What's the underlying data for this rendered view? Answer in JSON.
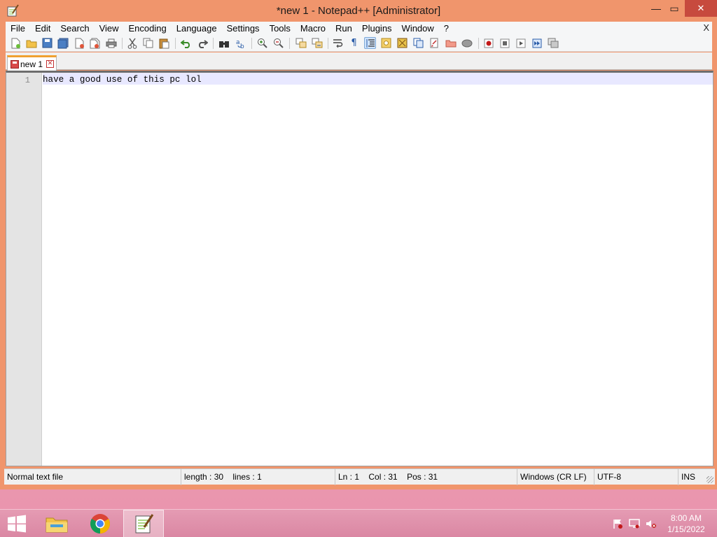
{
  "window": {
    "title": "*new 1 - Notepad++ [Administrator]",
    "controls": {
      "minimize": "—",
      "maximize": "▭",
      "close": "✕"
    }
  },
  "menu": {
    "items": [
      "File",
      "Edit",
      "Search",
      "View",
      "Encoding",
      "Language",
      "Settings",
      "Tools",
      "Macro",
      "Run",
      "Plugins",
      "Window",
      "?"
    ],
    "close_doc": "X"
  },
  "toolbar": {
    "icons": [
      "new-file-icon",
      "open-file-icon",
      "save-icon",
      "save-all-icon",
      "close-icon",
      "close-all-icon",
      "print-icon",
      "cut-icon",
      "copy-icon",
      "paste-icon",
      "undo-icon",
      "redo-icon",
      "find-icon",
      "replace-icon",
      "zoom-in-icon",
      "zoom-out-icon",
      "sync-vertical-icon",
      "sync-horizontal-icon",
      "word-wrap-icon",
      "show-all-chars-icon",
      "indent-guide-icon",
      "user-lang-icon",
      "doc-map-icon",
      "function-list-icon",
      "folder-workspace-icon",
      "monitoring-icon",
      "record-macro-icon",
      "stop-macro-icon",
      "play-macro-icon",
      "run-macro-multiple-icon",
      "save-macro-icon"
    ]
  },
  "tabs": [
    {
      "label": "new 1",
      "close": "✕"
    }
  ],
  "editor": {
    "line_number": "1",
    "text": "have a good use of this pc lol"
  },
  "status": {
    "file_type": "Normal text file",
    "length": "length : 30",
    "lines": "lines : 1",
    "ln": "Ln : 1",
    "col": "Col : 31",
    "pos": "Pos : 31",
    "eol": "Windows (CR LF)",
    "encoding": "UTF-8",
    "mode": "INS"
  },
  "taskbar": {
    "time": "8:00 AM",
    "date": "1/15/2022"
  },
  "colors": {
    "frame": "#f0956c",
    "close_button": "#c74a3e",
    "current_line": "#e8e8ff",
    "taskbar": "#da87a3"
  }
}
